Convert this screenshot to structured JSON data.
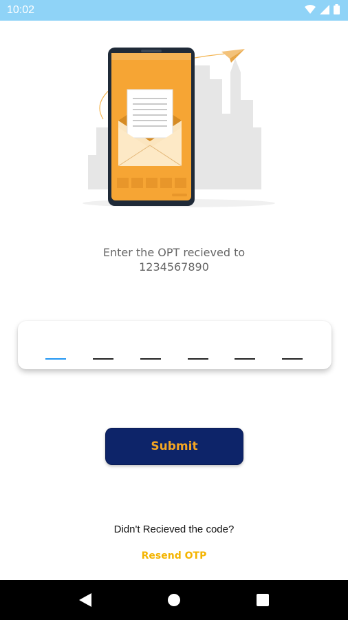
{
  "status_bar": {
    "time": "10:02",
    "icons": [
      "wifi-icon",
      "signal-icon",
      "battery-icon"
    ],
    "background": "#8fd3f7"
  },
  "illustration": {
    "name": "phone-envelope-illustration",
    "accent": "#f6a534"
  },
  "otp": {
    "prompt_line1": "Enter the OPT recieved to",
    "prompt_line2": "1234567890",
    "digits": [
      "",
      "",
      "",
      "",
      "",
      ""
    ],
    "active_index": 0,
    "active_color": "#2196f3"
  },
  "submit": {
    "label": "Submit",
    "background": "#0d2469",
    "text_color": "#f4a623"
  },
  "resend": {
    "question": "Didn't Recieved the code?",
    "link_label": "Resend OTP",
    "link_color": "#f4b400"
  },
  "nav_bar": {
    "buttons": [
      "back-icon",
      "home-icon",
      "recents-icon"
    ]
  }
}
